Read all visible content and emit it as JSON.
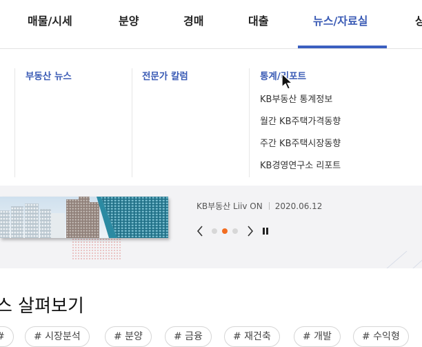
{
  "nav": {
    "items": [
      {
        "label": "매물/시세"
      },
      {
        "label": "분양"
      },
      {
        "label": "경매"
      },
      {
        "label": "대출"
      },
      {
        "label": "뉴스/자료실",
        "active": true
      },
      {
        "label": "상"
      }
    ]
  },
  "dropdown": {
    "columns": [
      {
        "title": "부동산 뉴스",
        "items": []
      },
      {
        "title": "전문가 칼럼",
        "items": []
      },
      {
        "title": "통계/리포트",
        "items": [
          "KB부동산 통계정보",
          "월간 KB주택가격동향",
          "주간 KB주택시장동향",
          "KB경영연구소 리포트"
        ]
      }
    ]
  },
  "slide": {
    "source": "KB부동산 Liiv ON",
    "date": "2020.06.12",
    "active_dot_index": 1,
    "dot_count": 3
  },
  "section": {
    "title_visible": "스 살펴보기"
  },
  "chips": [
    "#",
    "# 시장분석",
    "# 분양",
    "# 금융",
    "# 재건축",
    "# 개발",
    "# 수익형"
  ],
  "colors": {
    "accent": "#3b5fc0",
    "active_dot": "#f26d21",
    "title_link": "#3a5bb5"
  },
  "icons": [
    "prev-arrow-icon",
    "next-arrow-icon",
    "pause-icon",
    "mouse-cursor-icon"
  ]
}
